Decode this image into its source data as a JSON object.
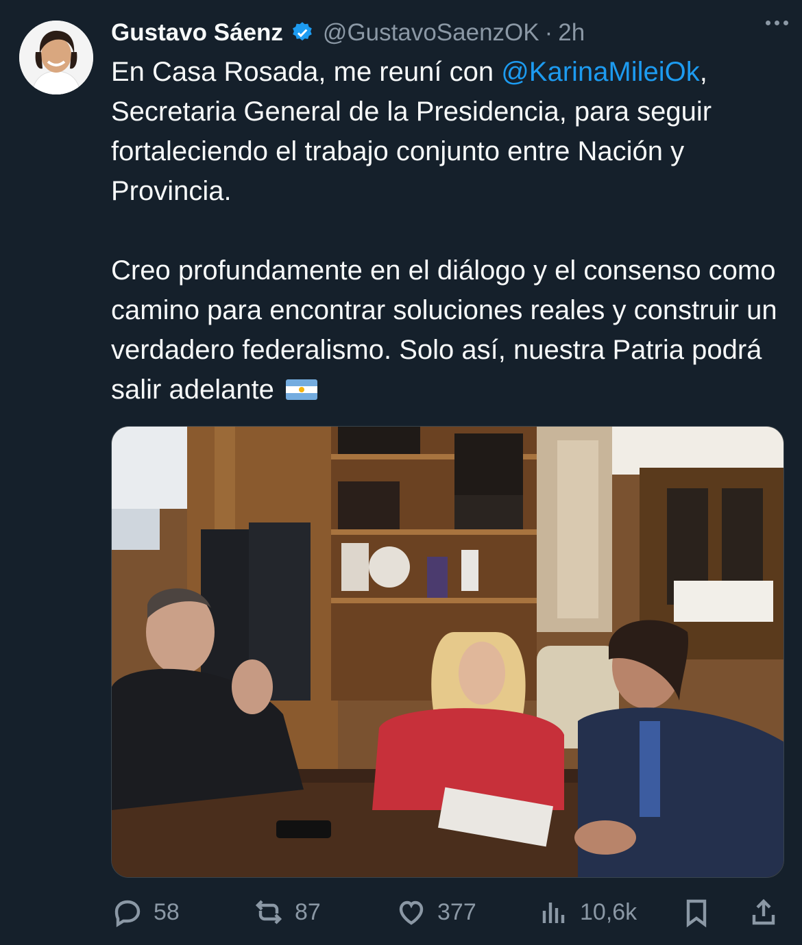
{
  "tweet": {
    "author_name": "Gustavo Sáenz",
    "handle": "@GustavoSaenzOK",
    "separator": "·",
    "time": "2h",
    "text_p1_before": "En Casa Rosada, me reuní con ",
    "mention": "@KarinaMileiOk",
    "text_p1_after": ", Secretaria General de la Presidencia, para seguir fortaleciendo el trabajo conjunto entre Nación y Provincia.",
    "text_p2": "Creo profundamente en el diálogo y el consenso como camino para encontrar soluciones reales y construir un verdadero federalismo. Solo así, nuestra Patria podrá salir adelante",
    "flag_emoji": "argentina-flag"
  },
  "actions": {
    "replies": "58",
    "reposts": "87",
    "likes": "377",
    "views": "10,6k"
  },
  "icons": [
    "verified-badge-icon",
    "more-icon",
    "reply-icon",
    "repost-icon",
    "like-icon",
    "views-icon",
    "bookmark-icon",
    "share-icon"
  ],
  "colors": {
    "background": "#15202b",
    "accent": "#1d9bf0",
    "muted": "#8b98a5",
    "text": "#f7f9f9"
  }
}
